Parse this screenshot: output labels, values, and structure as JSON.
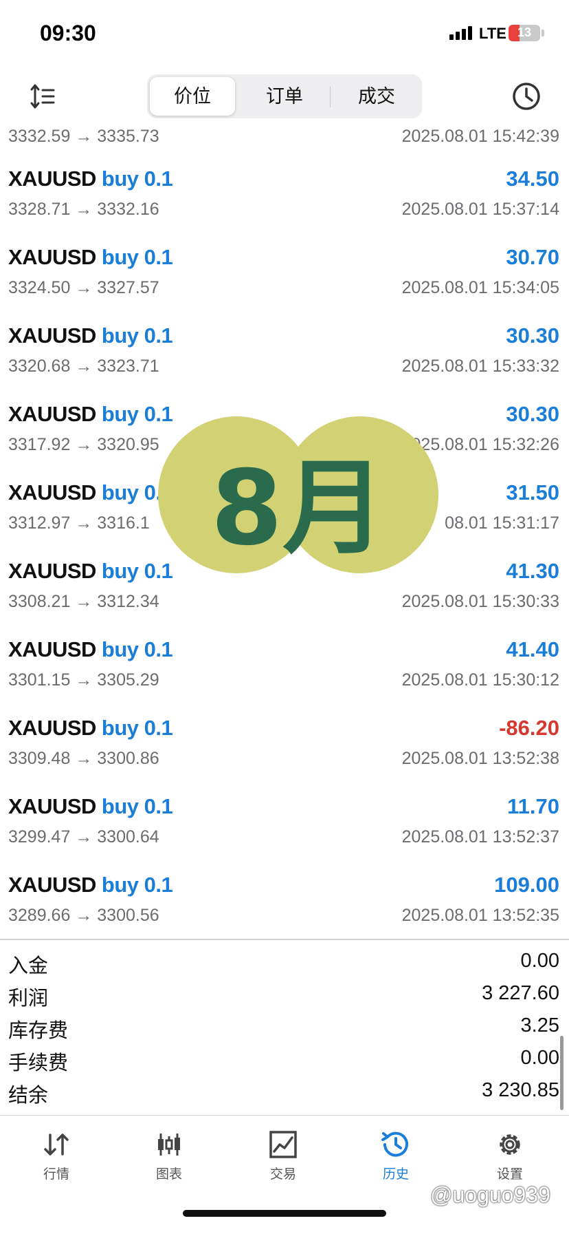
{
  "status_bar": {
    "time": "09:30",
    "network": "LTE",
    "battery": "13"
  },
  "toolbar": {
    "tabs": [
      "价位",
      "订单",
      "成交"
    ],
    "active_tab": 0
  },
  "trades": [
    {
      "symbol": "",
      "side": "",
      "profit": "",
      "price": "3332.59 → 3335.73",
      "time": "2025.08.01 15:42:39",
      "partial": true
    },
    {
      "symbol": "XAUUSD",
      "side": "buy 0.1",
      "profit": "34.50",
      "price": "3328.71 → 3332.16",
      "time": "2025.08.01 15:37:14"
    },
    {
      "symbol": "XAUUSD",
      "side": "buy 0.1",
      "profit": "30.70",
      "price": "3324.50 → 3327.57",
      "time": "2025.08.01 15:34:05"
    },
    {
      "symbol": "XAUUSD",
      "side": "buy 0.1",
      "profit": "30.30",
      "price": "3320.68 → 3323.71",
      "time": "2025.08.01 15:33:32"
    },
    {
      "symbol": "XAUUSD",
      "side": "buy 0.1",
      "profit": "30.30",
      "price": "3317.92 → 3320.95",
      "time": "2025.08.01 15:32:26"
    },
    {
      "symbol": "XAUUSD",
      "side": "buy 0.1",
      "profit": "31.50",
      "price": "3312.97 → 3316.1",
      "time": "08.01 15:31:17"
    },
    {
      "symbol": "XAUUSD",
      "side": "buy 0.1",
      "profit": "41.30",
      "price": "3308.21 → 3312.34",
      "time": "2025.08.01 15:30:33"
    },
    {
      "symbol": "XAUUSD",
      "side": "buy 0.1",
      "profit": "41.40",
      "price": "3301.15 → 3305.29",
      "time": "2025.08.01 15:30:12"
    },
    {
      "symbol": "XAUUSD",
      "side": "buy 0.1",
      "profit": "-86.20",
      "price": "3309.48 → 3300.86",
      "time": "2025.08.01 13:52:38",
      "negative": true
    },
    {
      "symbol": "XAUUSD",
      "side": "buy 0.1",
      "profit": "11.70",
      "price": "3299.47 → 3300.64",
      "time": "2025.08.01 13:52:37"
    },
    {
      "symbol": "XAUUSD",
      "side": "buy 0.1",
      "profit": "109.00",
      "price": "3289.66 → 3300.56",
      "time": "2025.08.01 13:52:35"
    }
  ],
  "summary": [
    {
      "label": "入金",
      "value": "0.00"
    },
    {
      "label": "利润",
      "value": "3 227.60"
    },
    {
      "label": "库存费",
      "value": "3.25"
    },
    {
      "label": "手续费",
      "value": "0.00"
    },
    {
      "label": "结余",
      "value": "3 230.85"
    }
  ],
  "tabbar": [
    {
      "label": "行情",
      "icon": "quotes-arrows-icon"
    },
    {
      "label": "图表",
      "icon": "candlestick-chart-icon"
    },
    {
      "label": "交易",
      "icon": "trade-line-chart-icon"
    },
    {
      "label": "历史",
      "icon": "history-clock-icon",
      "active": true
    },
    {
      "label": "设置",
      "icon": "settings-gear-icon"
    }
  ],
  "overlay": {
    "sticker_text": "8月",
    "watermark": "@uoguo939"
  },
  "colors": {
    "accent": "#1a7ed8",
    "negative": "#d4382f",
    "sticker": "#d2d274",
    "sticker_text": "#2a6b4e"
  }
}
